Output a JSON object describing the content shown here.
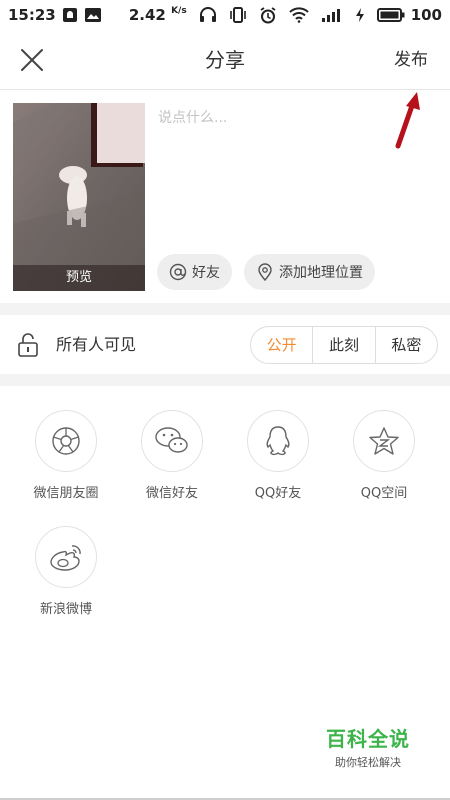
{
  "status_bar": {
    "time": "15:23",
    "net_speed": "2.42",
    "net_speed_unit": "K/s",
    "battery": "100"
  },
  "header": {
    "title": "分享",
    "publish_label": "发布"
  },
  "compose": {
    "placeholder": "说点什么...",
    "thumbnail_caption": "预览",
    "mention_label": "好友",
    "location_label": "添加地理位置"
  },
  "visibility": {
    "label": "所有人可见",
    "options": [
      "公开",
      "此刻",
      "私密"
    ],
    "selected": "公开"
  },
  "share_targets": [
    {
      "label": "微信朋友圈",
      "icon": "wechat-moments-icon"
    },
    {
      "label": "微信好友",
      "icon": "wechat-icon"
    },
    {
      "label": "QQ好友",
      "icon": "qq-icon"
    },
    {
      "label": "QQ空间",
      "icon": "qzone-icon"
    },
    {
      "label": "新浪微博",
      "icon": "weibo-icon"
    }
  ],
  "watermark": {
    "title": "百科全说",
    "subtitle": "助你轻松解决"
  },
  "colors": {
    "accent": "#f08c34",
    "annotation_arrow": "#b5121b",
    "watermark_green": "#3cb44a"
  }
}
